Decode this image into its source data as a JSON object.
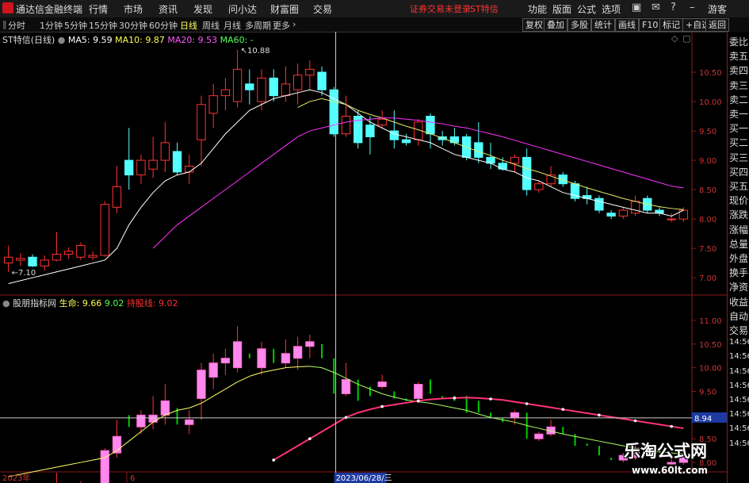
{
  "titlebar": {
    "app_title": "通达信金融终端",
    "menus": [
      "行情",
      "市场",
      "资讯",
      "发现",
      "问小达",
      "财富圈",
      "交易"
    ],
    "login_notice": "证券交易未登录",
    "stock_name": "ST特信",
    "right_menus": [
      "功能",
      "版面",
      "公式",
      "选项"
    ],
    "guest": "游客"
  },
  "toolbar": {
    "periods": [
      "分时",
      "1分钟",
      "5分钟",
      "15分钟",
      "30分钟",
      "60分钟",
      "日线",
      "周线",
      "月线",
      "多周期",
      "更多"
    ],
    "active_period": "日线",
    "buttons": [
      "复权",
      "叠加",
      "多股",
      "统计",
      "画线",
      "F10",
      "标记",
      "+自选",
      "返回"
    ]
  },
  "main_chart": {
    "title": "ST特信(日线)",
    "ma5_label": "MA5:",
    "ma5_value": "9.59",
    "ma10_label": "MA10:",
    "ma10_value": "9.87",
    "ma20_label": "MA20:",
    "ma20_value": "9.53",
    "ma60_label": "MA60:",
    "ma60_value": "-",
    "high_label": "10.88",
    "low_label": "7.10",
    "y_ticks": [
      "10.50",
      "10.00",
      "9.50",
      "9.00",
      "8.50",
      "8.00",
      "7.50",
      "7.00"
    ]
  },
  "indicator": {
    "title": "股朋指标网",
    "life_label": "生命:",
    "life_value": "9.66",
    "value2": "9.02",
    "hold_label": "持股线:",
    "hold_value": "9.02",
    "y_ticks": [
      "11.00",
      "10.50",
      "10.00",
      "9.50",
      "9.00",
      "8.50",
      "8.00"
    ],
    "crosshair_value": "8.94"
  },
  "xaxis": {
    "year_label": "2023年",
    "month_label": "6",
    "cursor_date": "2023/06/28/三"
  },
  "right_panel": {
    "items": [
      "委比",
      "卖五",
      "卖四",
      "卖三",
      "卖二",
      "卖一",
      "买一",
      "买二",
      "买三",
      "买四",
      "买五",
      "现价",
      "涨跌",
      "涨幅",
      "总量",
      "外盘",
      "换手",
      "净资",
      "收益",
      "自动",
      "交易",
      "14:56",
      "14:56",
      "14:56",
      "14:56",
      "14:56",
      "14:56",
      "14:56",
      "14:56"
    ]
  },
  "watermark": {
    "brand": "乐淘公式网",
    "url": "www.60lt.com"
  },
  "colors": {
    "up": "#ff3232",
    "down": "#54ffff",
    "ma5": "#ffffff",
    "ma10": "#e8e86a",
    "ma20": "#ff33ff",
    "life_up": "#ff66ff",
    "life_down": "#00cc00"
  },
  "chart_data": [
    {
      "type": "candlestick",
      "title": "ST特信(日线)",
      "ylim": [
        6.8,
        11.0
      ],
      "candles": [
        {
          "o": 7.25,
          "h": 7.55,
          "l": 7.1,
          "c": 7.35
        },
        {
          "o": 7.3,
          "h": 7.42,
          "l": 7.2,
          "c": 7.33
        },
        {
          "o": 7.35,
          "h": 7.4,
          "l": 7.18,
          "c": 7.2
        },
        {
          "o": 7.2,
          "h": 7.38,
          "l": 7.12,
          "c": 7.3
        },
        {
          "o": 7.3,
          "h": 7.78,
          "l": 7.28,
          "c": 7.4
        },
        {
          "o": 7.4,
          "h": 7.52,
          "l": 7.32,
          "c": 7.45
        },
        {
          "o": 7.35,
          "h": 7.6,
          "l": 7.3,
          "c": 7.55
        },
        {
          "o": 7.35,
          "h": 7.45,
          "l": 7.3,
          "c": 7.38
        },
        {
          "o": 7.38,
          "h": 8.3,
          "l": 7.36,
          "c": 8.25
        },
        {
          "o": 8.2,
          "h": 8.9,
          "l": 8.1,
          "c": 8.55
        },
        {
          "o": 9.0,
          "h": 9.55,
          "l": 8.5,
          "c": 8.75
        },
        {
          "o": 8.75,
          "h": 9.1,
          "l": 8.6,
          "c": 9.0
        },
        {
          "o": 8.85,
          "h": 9.4,
          "l": 8.7,
          "c": 9.0
        },
        {
          "o": 9.0,
          "h": 9.65,
          "l": 8.8,
          "c": 9.3
        },
        {
          "o": 9.15,
          "h": 9.3,
          "l": 8.75,
          "c": 8.8
        },
        {
          "o": 8.8,
          "h": 9.1,
          "l": 8.6,
          "c": 8.9
        },
        {
          "o": 9.35,
          "h": 10.1,
          "l": 8.9,
          "c": 9.95
        },
        {
          "o": 9.8,
          "h": 10.3,
          "l": 9.55,
          "c": 10.1
        },
        {
          "o": 10.1,
          "h": 10.4,
          "l": 9.85,
          "c": 10.2
        },
        {
          "o": 10.0,
          "h": 10.88,
          "l": 9.9,
          "c": 10.55
        },
        {
          "o": 10.3,
          "h": 10.55,
          "l": 9.95,
          "c": 10.2
        },
        {
          "o": 10.0,
          "h": 10.55,
          "l": 9.85,
          "c": 10.4
        },
        {
          "o": 10.4,
          "h": 10.55,
          "l": 10.0,
          "c": 10.1
        },
        {
          "o": 10.1,
          "h": 10.6,
          "l": 10.0,
          "c": 10.3
        },
        {
          "o": 10.2,
          "h": 10.65,
          "l": 9.95,
          "c": 10.45
        },
        {
          "o": 10.45,
          "h": 10.7,
          "l": 10.2,
          "c": 10.55
        },
        {
          "o": 10.5,
          "h": 10.6,
          "l": 10.1,
          "c": 10.2
        },
        {
          "o": 10.2,
          "h": 10.25,
          "l": 9.4,
          "c": 9.45
        },
        {
          "o": 9.45,
          "h": 10.1,
          "l": 9.4,
          "c": 9.75
        },
        {
          "o": 9.75,
          "h": 9.85,
          "l": 9.2,
          "c": 9.3
        },
        {
          "o": 9.6,
          "h": 9.75,
          "l": 9.1,
          "c": 9.4
        },
        {
          "o": 9.6,
          "h": 9.85,
          "l": 9.55,
          "c": 9.7
        },
        {
          "o": 9.5,
          "h": 9.85,
          "l": 9.2,
          "c": 9.35
        },
        {
          "o": 9.35,
          "h": 9.45,
          "l": 9.25,
          "c": 9.3
        },
        {
          "o": 9.35,
          "h": 9.7,
          "l": 9.25,
          "c": 9.65
        },
        {
          "o": 9.75,
          "h": 9.8,
          "l": 9.2,
          "c": 9.45
        },
        {
          "o": 9.4,
          "h": 9.5,
          "l": 9.25,
          "c": 9.35
        },
        {
          "o": 9.4,
          "h": 9.55,
          "l": 9.25,
          "c": 9.3
        },
        {
          "o": 9.4,
          "h": 9.45,
          "l": 9.0,
          "c": 9.05
        },
        {
          "o": 9.3,
          "h": 9.65,
          "l": 8.95,
          "c": 9.05
        },
        {
          "o": 9.05,
          "h": 9.3,
          "l": 8.85,
          "c": 8.95
        },
        {
          "o": 8.95,
          "h": 9.05,
          "l": 8.82,
          "c": 8.85
        },
        {
          "o": 8.95,
          "h": 9.1,
          "l": 8.8,
          "c": 9.05
        },
        {
          "o": 9.05,
          "h": 9.2,
          "l": 8.4,
          "c": 8.5
        },
        {
          "o": 8.5,
          "h": 8.65,
          "l": 8.45,
          "c": 8.6
        },
        {
          "o": 8.6,
          "h": 8.9,
          "l": 8.55,
          "c": 8.75
        },
        {
          "o": 8.75,
          "h": 8.8,
          "l": 8.55,
          "c": 8.6
        },
        {
          "o": 8.6,
          "h": 8.65,
          "l": 8.3,
          "c": 8.35
        },
        {
          "o": 8.4,
          "h": 8.55,
          "l": 8.25,
          "c": 8.35
        },
        {
          "o": 8.35,
          "h": 8.4,
          "l": 8.1,
          "c": 8.15
        },
        {
          "o": 8.1,
          "h": 8.15,
          "l": 8.0,
          "c": 8.05
        },
        {
          "o": 8.05,
          "h": 8.2,
          "l": 8.0,
          "c": 8.15
        },
        {
          "o": 8.1,
          "h": 8.4,
          "l": 8.05,
          "c": 8.3
        },
        {
          "o": 8.35,
          "h": 8.4,
          "l": 8.1,
          "c": 8.15
        },
        {
          "o": 8.15,
          "h": 8.2,
          "l": 8.05,
          "c": 8.1
        },
        {
          "o": 8.0,
          "h": 8.1,
          "l": 7.95,
          "c": 8.0
        },
        {
          "o": 8.0,
          "h": 8.2,
          "l": 7.95,
          "c": 8.15
        }
      ],
      "ma5": [
        6.9,
        6.95,
        7.0,
        7.05,
        7.1,
        7.15,
        7.2,
        7.25,
        7.3,
        7.5,
        7.9,
        8.2,
        8.45,
        8.65,
        8.75,
        8.8,
        8.95,
        9.2,
        9.45,
        9.65,
        9.85,
        9.95,
        10.05,
        10.1,
        10.15,
        10.2,
        10.15,
        10.05,
        9.95,
        9.8,
        9.65,
        9.55,
        9.45,
        9.4,
        9.35,
        9.3,
        9.2,
        9.1,
        9.05,
        9.0,
        8.95,
        8.85,
        8.8,
        8.7,
        8.65,
        8.55,
        8.45,
        8.4,
        8.35,
        8.3,
        8.25,
        8.2,
        8.15,
        8.1,
        8.1,
        8.05,
        8.15
      ],
      "ma10": [
        null,
        null,
        null,
        null,
        null,
        null,
        null,
        null,
        null,
        null,
        null,
        null,
        null,
        null,
        null,
        null,
        null,
        null,
        null,
        null,
        null,
        null,
        null,
        null,
        9.9,
        10.0,
        10.05,
        10.0,
        9.95,
        9.85,
        9.78,
        9.72,
        9.65,
        9.58,
        9.52,
        9.45,
        9.38,
        9.3,
        9.22,
        9.15,
        9.08,
        9.0,
        8.93,
        8.86,
        8.8,
        8.73,
        8.66,
        8.6,
        8.53,
        8.47,
        8.41,
        8.35,
        8.3,
        8.25,
        8.21,
        8.18,
        8.16
      ],
      "ma20": [
        null,
        null,
        null,
        null,
        null,
        null,
        null,
        null,
        null,
        null,
        null,
        null,
        7.5,
        7.7,
        7.9,
        8.05,
        8.2,
        8.35,
        8.5,
        8.65,
        8.8,
        8.95,
        9.1,
        9.25,
        9.4,
        9.5,
        9.55,
        9.6,
        9.65,
        9.68,
        9.7,
        9.72,
        9.72,
        9.7,
        9.68,
        9.65,
        9.62,
        9.58,
        9.55,
        9.5,
        9.45,
        9.4,
        9.34,
        9.28,
        9.22,
        9.16,
        9.1,
        9.04,
        8.98,
        8.92,
        8.86,
        8.8,
        8.74,
        8.68,
        8.62,
        8.56,
        8.53
      ]
    },
    {
      "type": "candlestick",
      "title": "股朋指标网",
      "ylim": [
        7.8,
        11.2
      ],
      "series_names": [
        "生命",
        "持股线"
      ],
      "life_line": [
        7.7,
        7.75,
        7.8,
        7.85,
        7.9,
        7.95,
        8.0,
        8.05,
        8.1,
        8.25,
        8.45,
        8.65,
        8.85,
        9.0,
        9.1,
        9.15,
        9.25,
        9.4,
        9.55,
        9.7,
        9.82,
        9.9,
        9.95,
        10.0,
        10.02,
        10.03,
        10.0,
        9.9,
        9.78,
        9.65,
        9.55,
        9.45,
        9.38,
        9.32,
        9.28,
        9.25,
        9.2,
        9.15,
        9.1,
        9.02,
        8.95,
        8.9,
        8.85,
        8.78,
        8.72,
        8.66,
        8.6,
        8.55,
        8.5,
        8.45,
        8.4,
        8.35,
        8.3,
        8.25,
        8.22,
        8.2,
        8.18
      ],
      "hold_line": [
        null,
        null,
        null,
        null,
        null,
        null,
        null,
        null,
        null,
        null,
        null,
        null,
        null,
        null,
        null,
        null,
        null,
        null,
        null,
        null,
        null,
        null,
        8.05,
        8.2,
        8.35,
        8.5,
        8.65,
        8.8,
        8.95,
        9.05,
        9.12,
        9.18,
        9.22,
        9.26,
        9.3,
        9.33,
        9.35,
        9.36,
        9.37,
        9.36,
        9.34,
        9.32,
        9.28,
        9.24,
        9.2,
        9.16,
        9.12,
        9.08,
        9.04,
        9.0,
        8.96,
        8.92,
        8.88,
        8.84,
        8.8,
        8.76,
        8.72
      ]
    }
  ]
}
